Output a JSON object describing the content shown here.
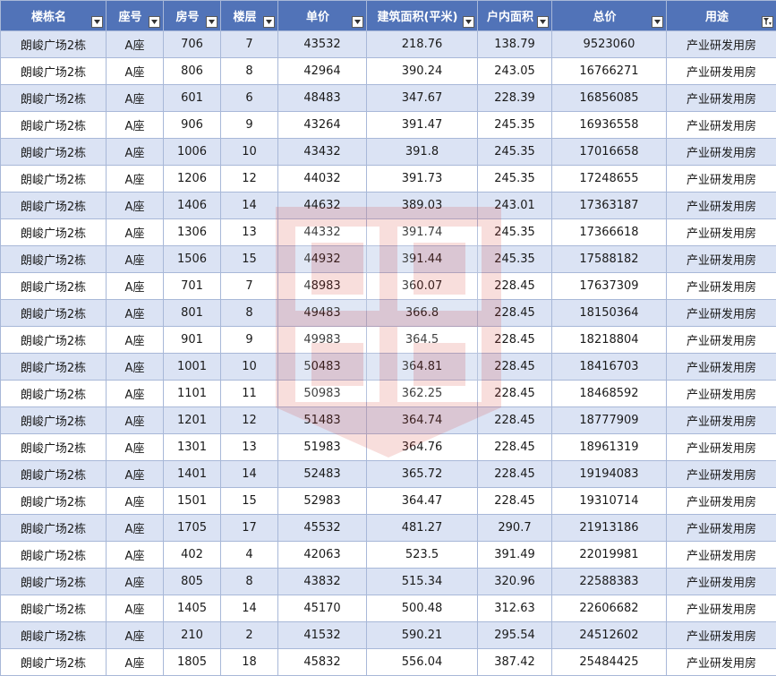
{
  "columns": [
    "楼栋名",
    "座号",
    "房号",
    "楼层",
    "单价",
    "建筑面积(平米)",
    "户内面积",
    "总价",
    "用途"
  ],
  "rows": [
    [
      "朗峻广场2栋",
      "A座",
      "706",
      "7",
      "43532",
      "218.76",
      "138.79",
      "9523060",
      "产业研发用房"
    ],
    [
      "朗峻广场2栋",
      "A座",
      "806",
      "8",
      "42964",
      "390.24",
      "243.05",
      "16766271",
      "产业研发用房"
    ],
    [
      "朗峻广场2栋",
      "A座",
      "601",
      "6",
      "48483",
      "347.67",
      "228.39",
      "16856085",
      "产业研发用房"
    ],
    [
      "朗峻广场2栋",
      "A座",
      "906",
      "9",
      "43264",
      "391.47",
      "245.35",
      "16936558",
      "产业研发用房"
    ],
    [
      "朗峻广场2栋",
      "A座",
      "1006",
      "10",
      "43432",
      "391.8",
      "245.35",
      "17016658",
      "产业研发用房"
    ],
    [
      "朗峻广场2栋",
      "A座",
      "1206",
      "12",
      "44032",
      "391.73",
      "245.35",
      "17248655",
      "产业研发用房"
    ],
    [
      "朗峻广场2栋",
      "A座",
      "1406",
      "14",
      "44632",
      "389.03",
      "243.01",
      "17363187",
      "产业研发用房"
    ],
    [
      "朗峻广场2栋",
      "A座",
      "1306",
      "13",
      "44332",
      "391.74",
      "245.35",
      "17366618",
      "产业研发用房"
    ],
    [
      "朗峻广场2栋",
      "A座",
      "1506",
      "15",
      "44932",
      "391.44",
      "245.35",
      "17588182",
      "产业研发用房"
    ],
    [
      "朗峻广场2栋",
      "A座",
      "701",
      "7",
      "48983",
      "360.07",
      "228.45",
      "17637309",
      "产业研发用房"
    ],
    [
      "朗峻广场2栋",
      "A座",
      "801",
      "8",
      "49483",
      "366.8",
      "228.45",
      "18150364",
      "产业研发用房"
    ],
    [
      "朗峻广场2栋",
      "A座",
      "901",
      "9",
      "49983",
      "364.5",
      "228.45",
      "18218804",
      "产业研发用房"
    ],
    [
      "朗峻广场2栋",
      "A座",
      "1001",
      "10",
      "50483",
      "364.81",
      "228.45",
      "18416703",
      "产业研发用房"
    ],
    [
      "朗峻广场2栋",
      "A座",
      "1101",
      "11",
      "50983",
      "362.25",
      "228.45",
      "18468592",
      "产业研发用房"
    ],
    [
      "朗峻广场2栋",
      "A座",
      "1201",
      "12",
      "51483",
      "364.74",
      "228.45",
      "18777909",
      "产业研发用房"
    ],
    [
      "朗峻广场2栋",
      "A座",
      "1301",
      "13",
      "51983",
      "364.76",
      "228.45",
      "18961319",
      "产业研发用房"
    ],
    [
      "朗峻广场2栋",
      "A座",
      "1401",
      "14",
      "52483",
      "365.72",
      "228.45",
      "19194083",
      "产业研发用房"
    ],
    [
      "朗峻广场2栋",
      "A座",
      "1501",
      "15",
      "52983",
      "364.47",
      "228.45",
      "19310714",
      "产业研发用房"
    ],
    [
      "朗峻广场2栋",
      "A座",
      "1705",
      "17",
      "45532",
      "481.27",
      "290.7",
      "21913186",
      "产业研发用房"
    ],
    [
      "朗峻广场2栋",
      "A座",
      "402",
      "4",
      "42063",
      "523.5",
      "391.49",
      "22019981",
      "产业研发用房"
    ],
    [
      "朗峻广场2栋",
      "A座",
      "805",
      "8",
      "43832",
      "515.34",
      "320.96",
      "22588383",
      "产业研发用房"
    ],
    [
      "朗峻广场2栋",
      "A座",
      "1405",
      "14",
      "45170",
      "500.48",
      "312.63",
      "22606682",
      "产业研发用房"
    ],
    [
      "朗峻广场2栋",
      "A座",
      "210",
      "2",
      "41532",
      "590.21",
      "295.54",
      "24512602",
      "产业研发用房"
    ],
    [
      "朗峻广场2栋",
      "A座",
      "1805",
      "18",
      "45832",
      "556.04",
      "387.42",
      "25484425",
      "产业研发用房"
    ]
  ],
  "filter_icon": "filter-dropdown-icon",
  "sorted_filter_icon": "filter-active-icon",
  "colors": {
    "header_bg": "#5173b8",
    "header_text": "#ffffff",
    "band_row": "#dbe3f4",
    "plain_row": "#ffffff",
    "grid_line": "#a8b8d8",
    "watermark": "#d9372f"
  }
}
